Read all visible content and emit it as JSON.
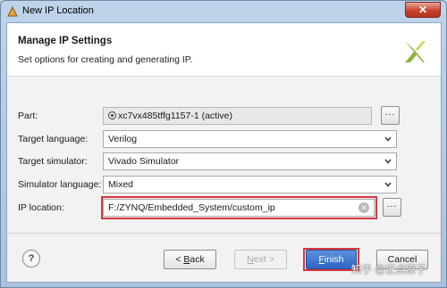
{
  "window": {
    "title": "New IP Location",
    "close_label": "✕"
  },
  "header": {
    "title": "Manage IP Settings",
    "subtitle": "Set options for creating and generating IP."
  },
  "form": {
    "part": {
      "label": "Part:",
      "value": "xc7vx485tffg1157-1 (active)",
      "more": "..."
    },
    "target_language": {
      "label": "Target language:",
      "value": "Verilog"
    },
    "target_simulator": {
      "label": "Target simulator:",
      "value": "Vivado Simulator"
    },
    "simulator_language": {
      "label": "Simulator language:",
      "value": "Mixed"
    },
    "ip_location": {
      "label": "IP location:",
      "value": "F:/ZYNQ/Embedded_System/custom_ip",
      "more": "..."
    }
  },
  "footer": {
    "help": "?",
    "back_lt": "< ",
    "back_key": "B",
    "back_rest": "ack",
    "next_key": "N",
    "next_rest": "ext >",
    "finish_key": "F",
    "finish_rest": "inish",
    "cancel": "Cancel"
  },
  "watermark": "知乎 @正点原子",
  "colors": {
    "highlight": "#d9363e",
    "primary_button": "#2f66c4",
    "logo": "#8fb339"
  }
}
